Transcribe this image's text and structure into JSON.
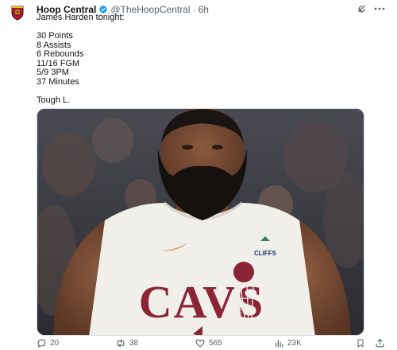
{
  "author": {
    "display_name": "Hoop Central",
    "handle": "@TheHoopCentral",
    "separator": "·",
    "time": "6h",
    "verified": true,
    "avatar_icon": "hoop-central-logo-icon"
  },
  "tweet": {
    "lines": [
      "James Harden tonight:",
      "",
      "30 Points",
      "8 Assists",
      "6 Rebounds",
      "11/16 FGM",
      "5/9 3PM",
      "37 Minutes",
      "",
      "Tough L."
    ]
  },
  "media": {
    "jersey_text": "CAVS",
    "patch_text": "CLIFFS"
  },
  "actions": {
    "replies": "20",
    "reposts": "38",
    "likes": "565",
    "views": "23K"
  },
  "colors": {
    "text_primary": "#0f1419",
    "text_secondary": "#536471",
    "verified_blue": "#1d9bf0",
    "jersey_wine": "#8a2536",
    "jersey_white": "#f1efe9",
    "border": "#cfd9de"
  },
  "icons": {
    "verified": "verified-badge-icon",
    "grok": "grok-icon",
    "more": "more-icon",
    "reply": "reply-icon",
    "repost": "repost-icon",
    "like": "like-icon",
    "views": "views-icon",
    "bookmark": "bookmark-icon",
    "share": "share-icon"
  }
}
